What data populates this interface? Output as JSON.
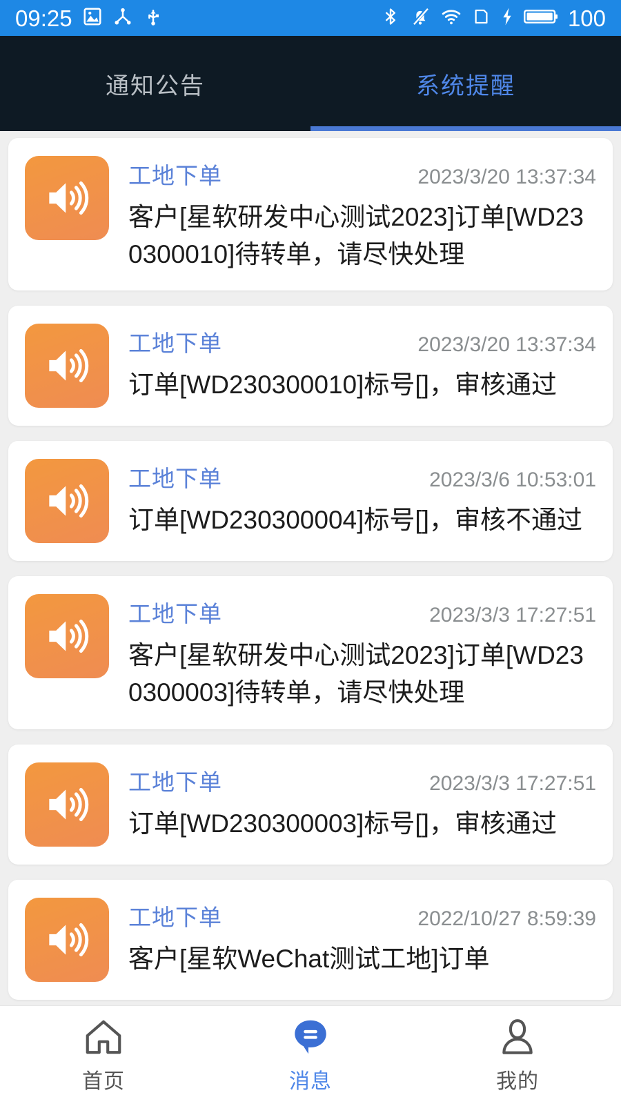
{
  "status_bar": {
    "time": "09:25",
    "battery_level": "100",
    "left_icons": [
      "image-icon",
      "share-nodes-icon",
      "usb-icon"
    ],
    "right_icons": [
      "bluetooth-icon",
      "mute-bell-icon",
      "wifi-icon",
      "sim-card-icon",
      "charging-bolt-icon",
      "battery-icon"
    ],
    "colors": {
      "background": "#1E88E5",
      "foreground": "#FFFFFF"
    }
  },
  "tabs": {
    "background": "#0E1A24",
    "active_color": "#4F87E8",
    "inactive_color": "#B9BFC5",
    "underline_color": "#4A79D4",
    "items": [
      {
        "label": "通知公告",
        "active": false
      },
      {
        "label": "系统提醒",
        "active": true
      }
    ]
  },
  "messages": [
    {
      "icon": "speaker-icon",
      "title": "工地下单",
      "time": "2023/3/20 13:37:34",
      "text": "客户[星软研发中心测试2023]订单[WD230300010]待转单，请尽快处理"
    },
    {
      "icon": "speaker-icon",
      "title": "工地下单",
      "time": "2023/3/20 13:37:34",
      "text": "订单[WD230300010]标号[]，审核通过"
    },
    {
      "icon": "speaker-icon",
      "title": "工地下单",
      "time": "2023/3/6 10:53:01",
      "text": "订单[WD230300004]标号[]，审核不通过"
    },
    {
      "icon": "speaker-icon",
      "title": "工地下单",
      "time": "2023/3/3 17:27:51",
      "text": "客户[星软研发中心测试2023]订单[WD230300003]待转单，请尽快处理"
    },
    {
      "icon": "speaker-icon",
      "title": "工地下单",
      "time": "2023/3/3 17:27:51",
      "text": "订单[WD230300003]标号[]，审核通过"
    },
    {
      "icon": "speaker-icon",
      "title": "工地下单",
      "time": "2022/10/27 8:59:39",
      "text": "客户[星软WeChat测试工地]订单"
    }
  ],
  "bottom_nav": {
    "active_color": "#4F87E8",
    "inactive_color": "#555555",
    "items": [
      {
        "label": "首页",
        "icon": "home-icon",
        "active": false
      },
      {
        "label": "消息",
        "icon": "message-bubble-icon",
        "active": true
      },
      {
        "label": "我的",
        "icon": "person-icon",
        "active": false
      }
    ]
  },
  "theme": {
    "page_background": "#EFEFEF",
    "card_background": "#FFFFFF",
    "icon_orange": "#F3983F",
    "title_blue": "#5B82D8",
    "time_gray": "#8A8E90",
    "body_text": "#1C1C1C"
  }
}
